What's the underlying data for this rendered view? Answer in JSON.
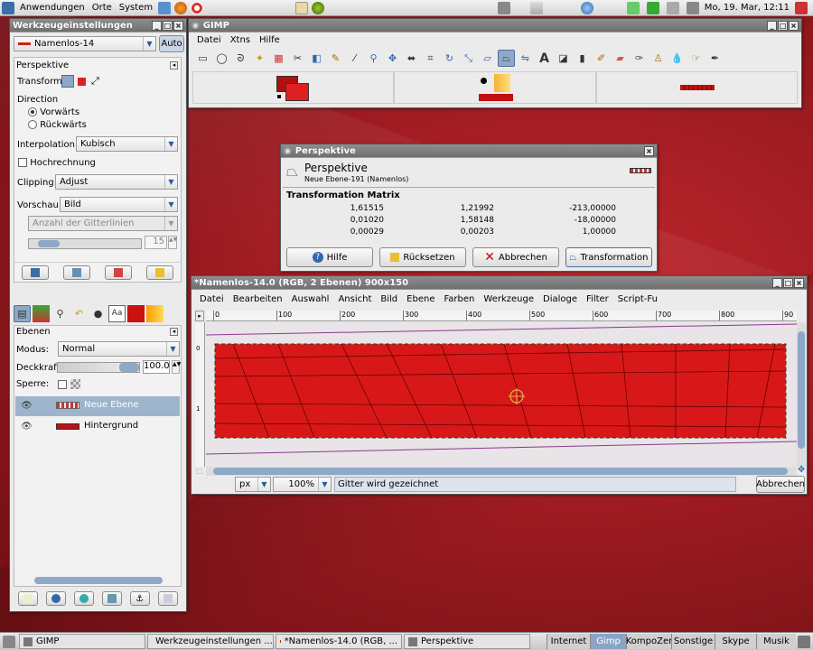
{
  "top_panel": {
    "menus": [
      "Anwendungen",
      "Orte",
      "System"
    ],
    "clock": "Mo, 19. Mar, 12:11"
  },
  "tool_options": {
    "title": "Werkzeugeinstellungen",
    "image_selector": "Namenlos-14",
    "auto_label": "Auto",
    "tool_name": "Perspektive",
    "transform_label": "Transform:",
    "direction_label": "Direction",
    "direction_options": [
      "Vorwärts",
      "Rückwärts"
    ],
    "interpolation_label": "Interpolation:",
    "interpolation_value": "Kubisch",
    "supersample_label": "Hochrechnung",
    "clipping_label": "Clipping:",
    "clipping_value": "Adjust",
    "preview_label": "Vorschau:",
    "preview_value": "Bild",
    "grid_select": "Anzahl der Gitterlinien",
    "grid_value": "15",
    "layers_title": "Ebenen",
    "mode_label": "Modus:",
    "mode_value": "Normal",
    "opacity_label": "Deckkraft:",
    "opacity_value": "100.0",
    "lock_label": "Sperre:",
    "layers": [
      {
        "name": "Neue Ebene"
      },
      {
        "name": "Hintergrund"
      }
    ],
    "text_tab": "Aa"
  },
  "gimp_main": {
    "title": "GIMP",
    "menus": [
      "Datei",
      "Xtns",
      "Hilfe"
    ]
  },
  "perspective_dialog": {
    "window_title": "Perspektive",
    "heading": "Perspektive",
    "subheading": "Neue Ebene-191 (Namenlos)",
    "matrix_title": "Transformation Matrix",
    "matrix": [
      [
        "1,61515",
        "1,21992",
        "-213,00000"
      ],
      [
        "0,01020",
        "1,58148",
        "-18,00000"
      ],
      [
        "0,00029",
        "0,00203",
        "1,00000"
      ]
    ],
    "buttons": {
      "help": "Hilfe",
      "reset": "Rücksetzen",
      "cancel": "Abbrechen",
      "transform": "Transformation"
    }
  },
  "image_window": {
    "title": "*Namenlos-14.0 (RGB, 2 Ebenen) 900x150",
    "menus": [
      "Datei",
      "Bearbeiten",
      "Auswahl",
      "Ansicht",
      "Bild",
      "Ebene",
      "Farben",
      "Werkzeuge",
      "Dialoge",
      "Filter",
      "Script-Fu"
    ],
    "ruler_ticks": [
      "0",
      "100",
      "200",
      "300",
      "400",
      "500",
      "600",
      "700",
      "800",
      "90"
    ],
    "unit": "px",
    "zoom": "100%",
    "status": "Gitter wird gezeichnet",
    "cancel": "Abbrechen"
  },
  "taskbar": {
    "tasks": [
      "GIMP",
      "Werkzeugeinstellungen ...",
      "*Namenlos-14.0 (RGB, ...",
      "Perspektive"
    ],
    "workspaces": [
      "Internet",
      "Gimp",
      "KompoZer",
      "Sonstige",
      "Skype",
      "Musik"
    ]
  },
  "colors": {
    "accent": "#d42020",
    "selection": "#8ea8c8"
  }
}
